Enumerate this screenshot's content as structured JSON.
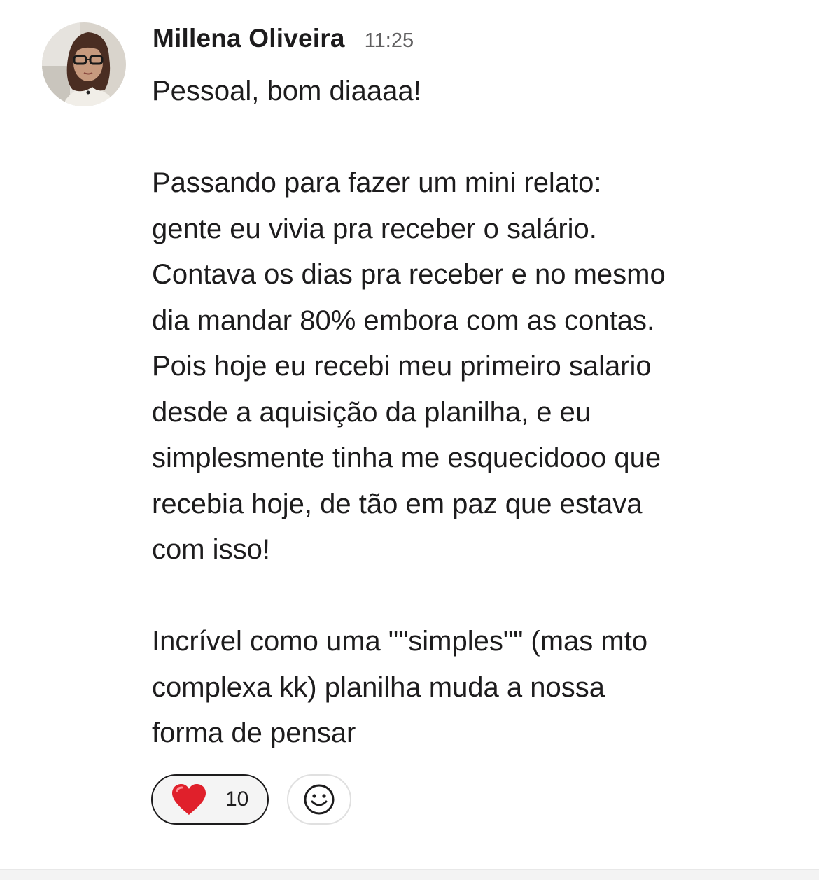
{
  "message": {
    "author": "Millena Oliveira",
    "time": "11:25",
    "lines": [
      "Pessoal, bom diaaaa!",
      "",
      "Passando para fazer um mini relato:",
      "gente eu vivia pra receber o salário.",
      "Contava os dias pra receber e no mesmo",
      "dia mandar 80% embora com as contas.",
      "Pois hoje eu recebi meu primeiro salario",
      "desde a aquisição da planilha, e eu",
      "simplesmente tinha me esquecidooo que",
      "recebia hoje, de tão em paz que estava",
      "com isso!",
      "",
      "Incrível como uma \"\"simples\"\" (mas mto",
      "complexa kk) planilha muda a nossa",
      "forma de pensar"
    ]
  },
  "reactions": [
    {
      "emoji": "heart-emoji",
      "count": "10"
    }
  ],
  "add_reaction_icon": "smiley-add-reaction-icon",
  "colors": {
    "text": "#1d1c1d",
    "timestamp": "#616061",
    "reaction_border": "#1d1c1d",
    "reaction_bg": "#f4f4f4",
    "heart": "#e0202b"
  }
}
